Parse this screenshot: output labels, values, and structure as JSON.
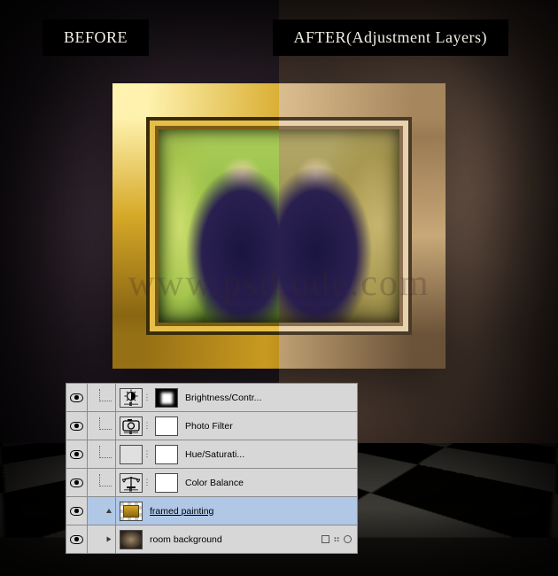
{
  "labels": {
    "before": "BEFORE",
    "after": "AFTER(Adjustment Layers)"
  },
  "watermark": "www.psd  ude.com",
  "layers": {
    "brightness": "Brightness/Contr...",
    "photofilter": "Photo Filter",
    "huesat": "Hue/Saturati...",
    "colorbalance": "Color Balance",
    "framed": "framed painting",
    "room": "room background"
  }
}
